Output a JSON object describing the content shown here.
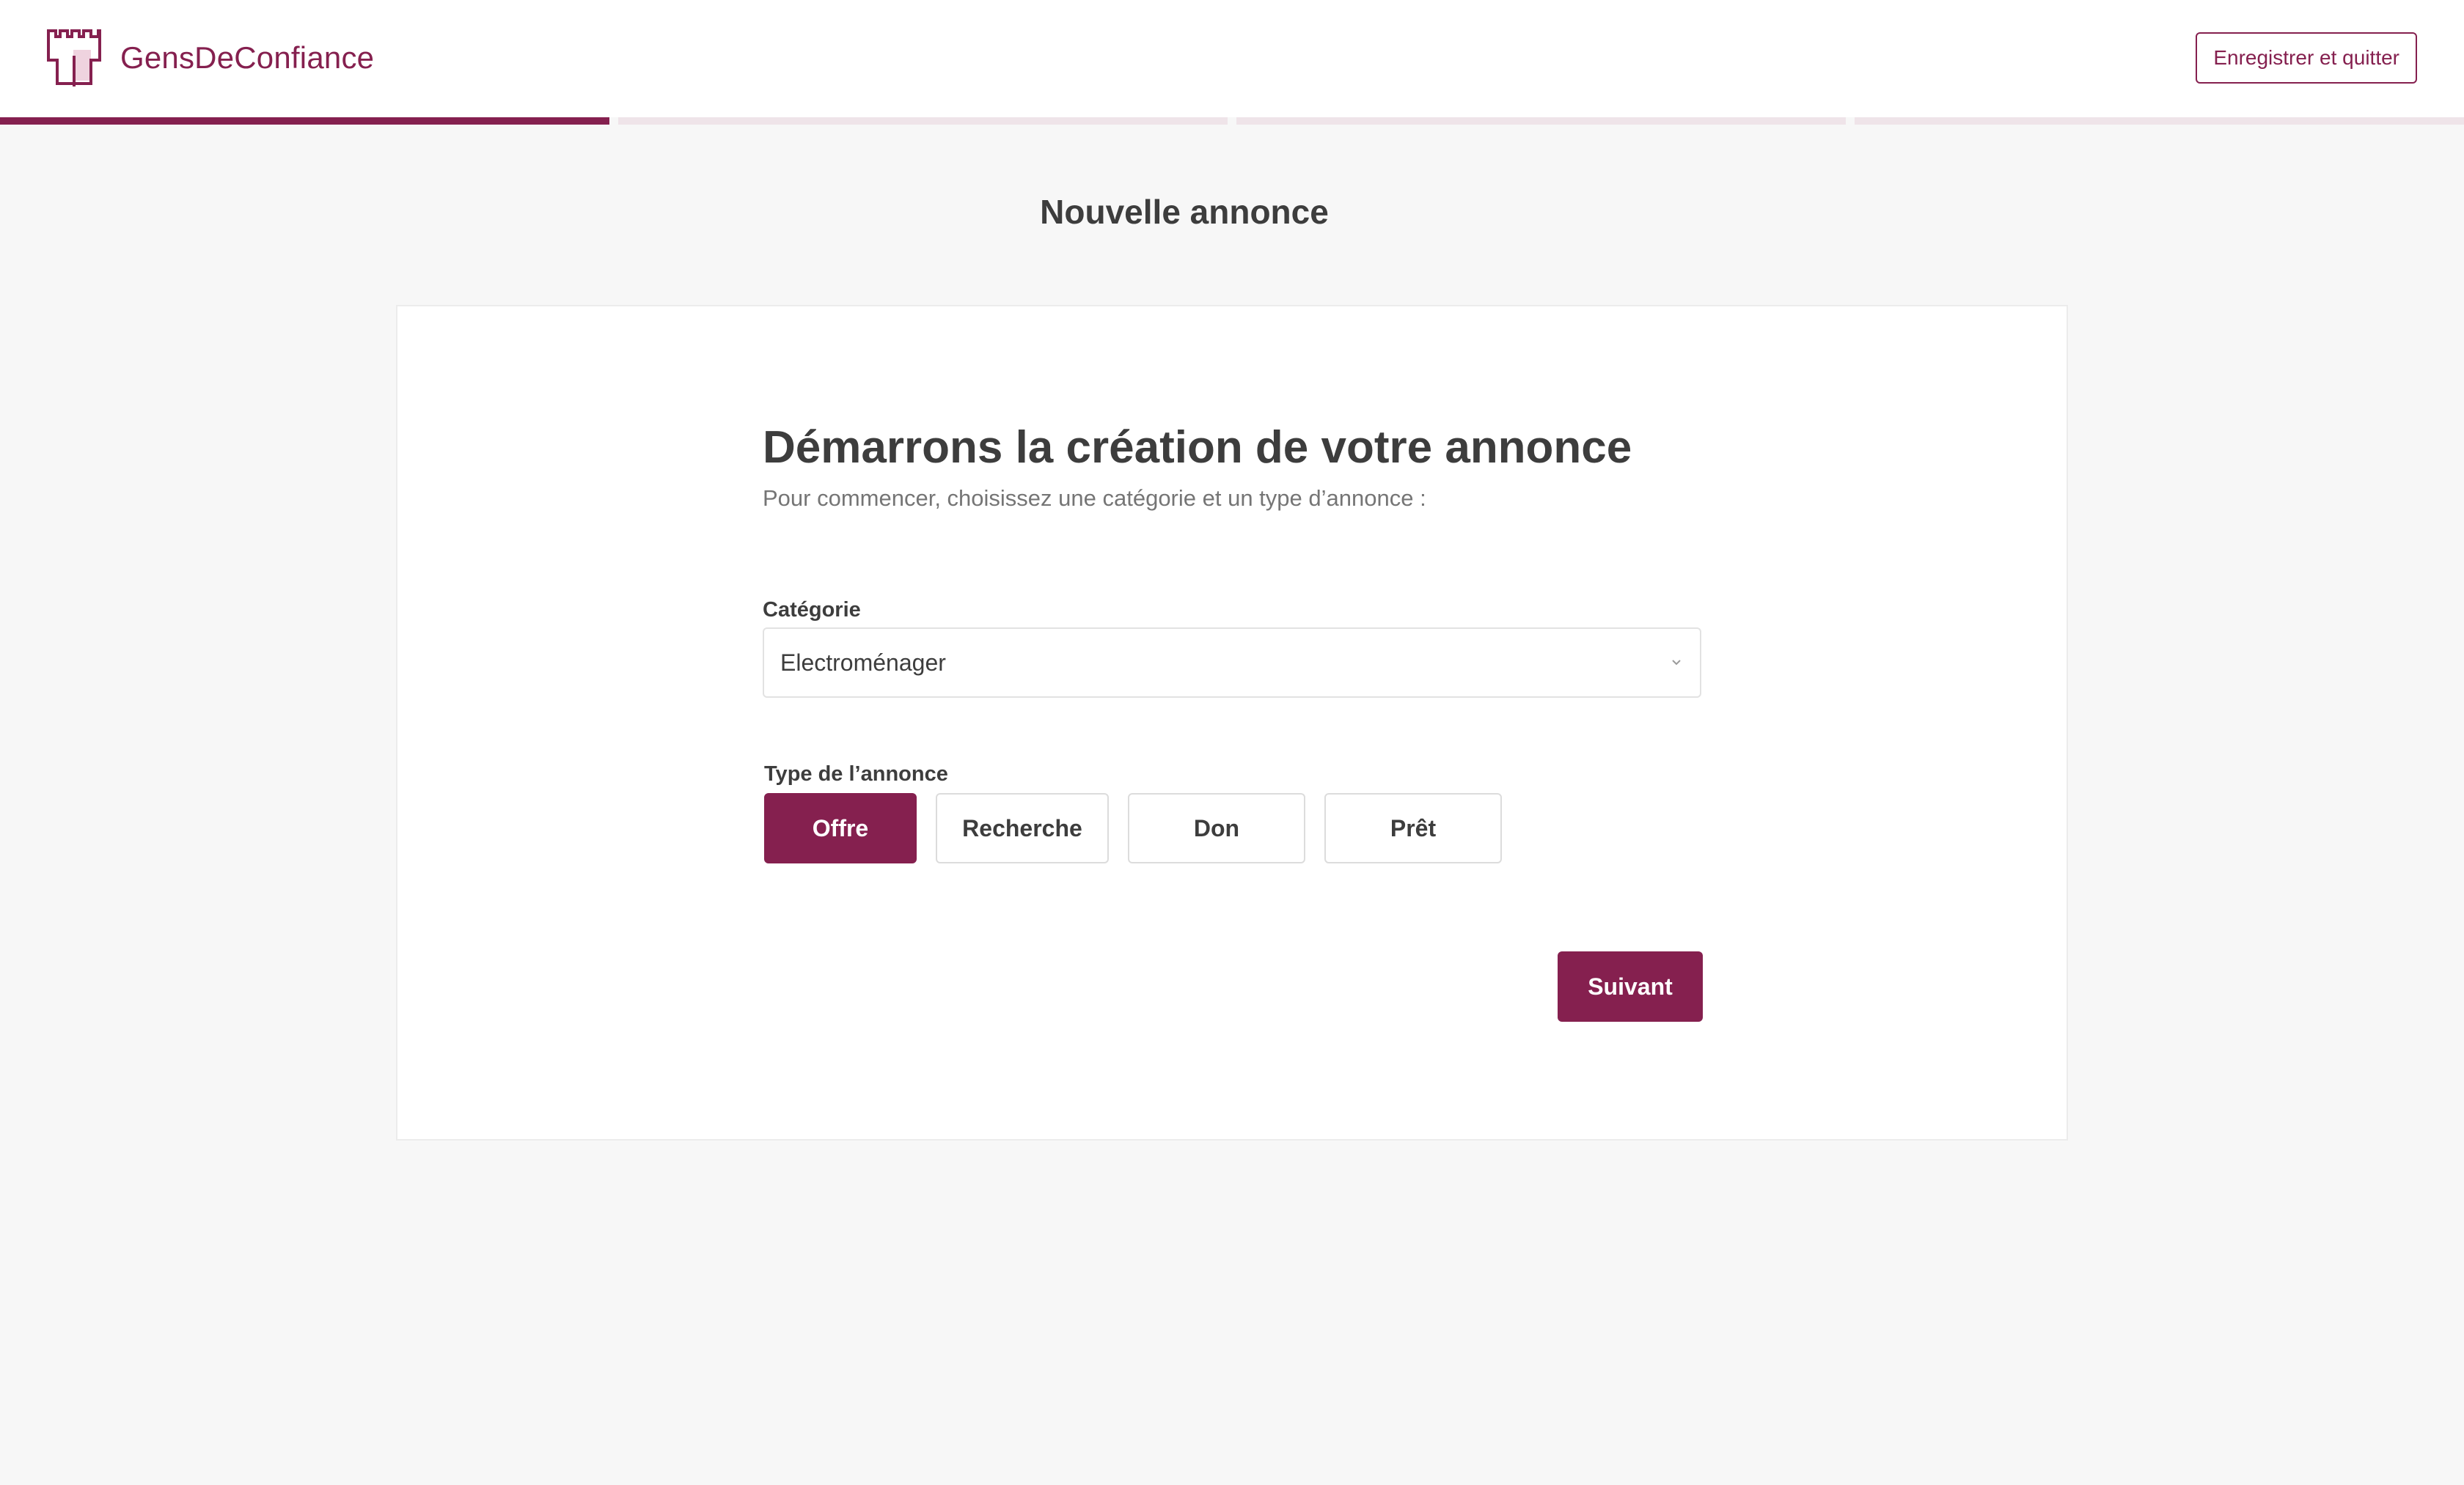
{
  "header": {
    "brand": "GensDeConfiance",
    "save_quit_label": "Enregistrer et quitter"
  },
  "progress": {
    "total_steps": 4,
    "current_step": 1
  },
  "page": {
    "title": "Nouvelle annonce"
  },
  "form": {
    "title": "Démarrons la création de votre annonce",
    "subtitle": "Pour commencer, choisissez une catégorie et un type d’annonce :",
    "category": {
      "label": "Catégorie",
      "value": "Electroménager"
    },
    "type": {
      "label": "Type de l’annonce",
      "options": [
        "Offre",
        "Recherche",
        "Don",
        "Prêt"
      ],
      "selected": "Offre"
    },
    "next_label": "Suivant"
  },
  "colors": {
    "accent": "#85204f",
    "background": "#f7f7f7",
    "progress_inactive": "#efe4e9",
    "text": "#3d3d3d",
    "muted_text": "#757575"
  },
  "icons": {
    "logo": "castle-tower-icon",
    "select": "chevron-down-icon"
  }
}
